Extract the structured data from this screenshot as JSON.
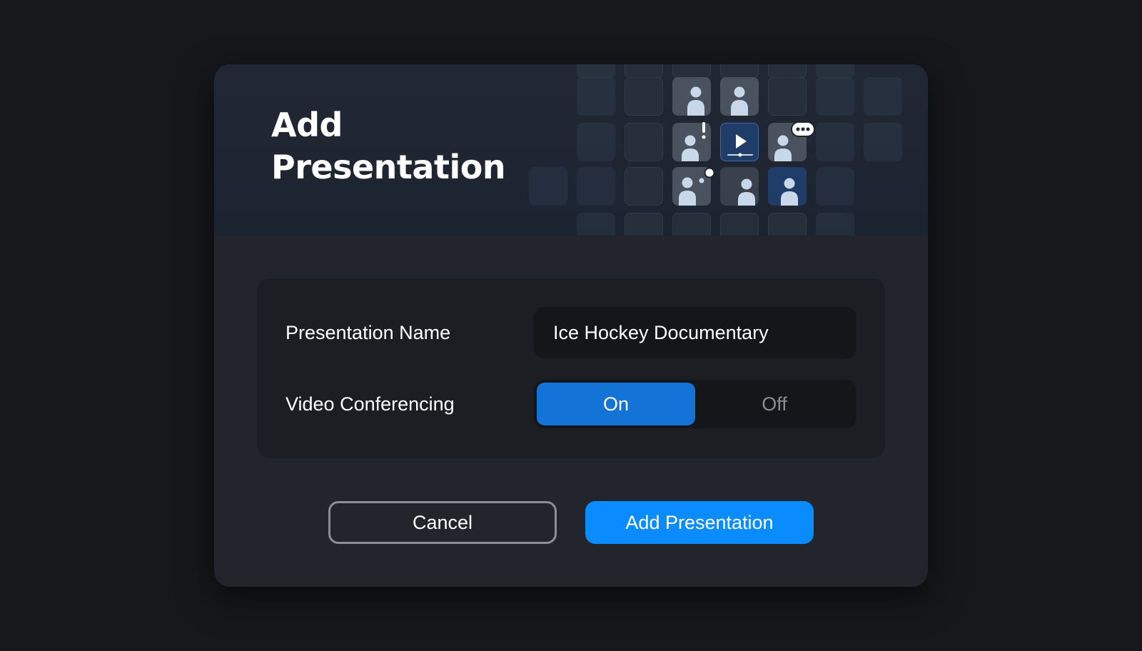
{
  "dialog": {
    "title": "Add Presentation",
    "form": {
      "name_label": "Presentation Name",
      "name_value": "Ice Hockey Documentary",
      "video_label": "Video Conferencing",
      "video_options": [
        "On",
        "Off"
      ],
      "video_selected": "On"
    },
    "buttons": {
      "cancel": "Cancel",
      "submit": "Add Presentation"
    },
    "illustration": {
      "icons": [
        "person-icon",
        "exclamation-icon",
        "play-icon",
        "chat-bubble-icon",
        "thought-bubble-icon"
      ]
    }
  },
  "colors": {
    "page_bg": "#17181b",
    "dialog_bg": "#22252b",
    "panel_bg": "#1c1e23",
    "input_bg": "#15161a",
    "accent_on": "#1473d6",
    "primary_button": "#0a8cff",
    "cancel_border": "#8a8e96",
    "muted_text": "#8a8d93"
  }
}
